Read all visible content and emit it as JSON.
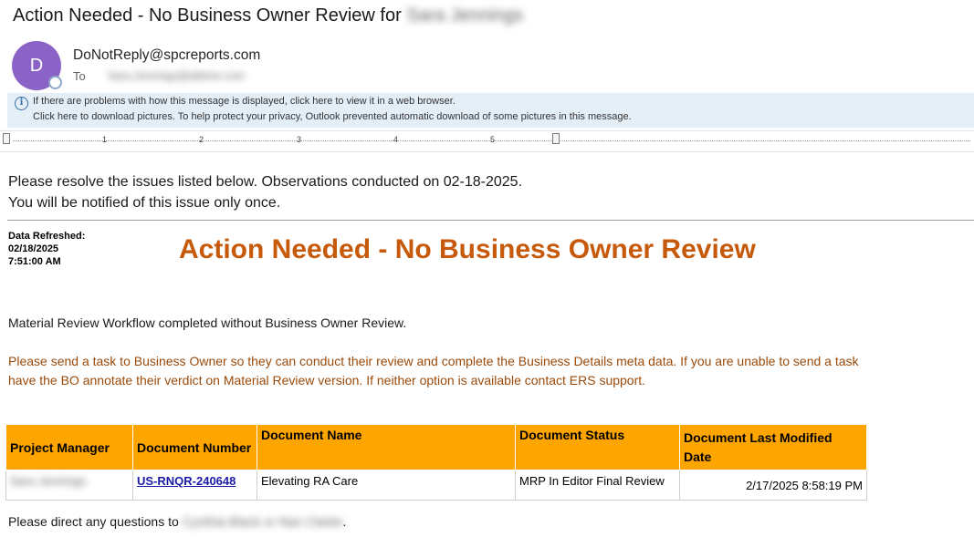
{
  "subject": {
    "prefix": "Action Needed - No Business Owner Review for",
    "recipient_name": "Sara Jennings"
  },
  "header": {
    "avatar_initial": "D",
    "sender": "DoNotReply@spcreports.com",
    "to_label": "To",
    "to_value": "Sara.Jennings@abbvie.com"
  },
  "infobar": {
    "line1": "If there are problems with how this message is displayed, click here to view it in a web browser.",
    "line2": "Click here to download pictures. To help protect your privacy, Outlook prevented automatic download of some pictures in this message."
  },
  "ruler": {
    "numbers": [
      "1",
      "2",
      "3",
      "4",
      "5"
    ]
  },
  "body": {
    "intro1": "Please resolve the issues listed below. Observations conducted on 02-18-2025.",
    "intro2": "You will be notified of this issue only once.",
    "refresh_label": "Data Refreshed:",
    "refresh_date": "02/18/2025",
    "refresh_time": "7:51:00 AM",
    "title": "Action Needed - No Business Owner Review",
    "para1": "Material Review Workflow completed without Business Owner Review.",
    "para2": "Please send a task to Business Owner so they can conduct their review and complete the Business Details meta data. If you are unable to send a task have the BO annotate their verdict on Material Review version. If neither option is available contact ERS support.",
    "closing_prefix": "Please direct any questions to",
    "closing_names": "Cynthia Black or Nan Clarke",
    "closing_suffix": "."
  },
  "table": {
    "headers": [
      "Project Manager",
      "Document Number",
      "Document Name",
      "Document Status",
      "Document Last Modified Date"
    ],
    "row": {
      "project_manager": "Sara Jennings",
      "document_number": "US-RNQR-240648",
      "document_name": "Elevating RA Care",
      "document_status": "MRP In Editor Final Review",
      "last_modified": "2/17/2025 8:58:19 PM"
    }
  },
  "colors": {
    "accent_orange": "#c65a0a",
    "table_header": "#fea500",
    "infobar_bg": "#e3eef7",
    "avatar": "#8b63c7",
    "link": "#1a1aa6"
  }
}
